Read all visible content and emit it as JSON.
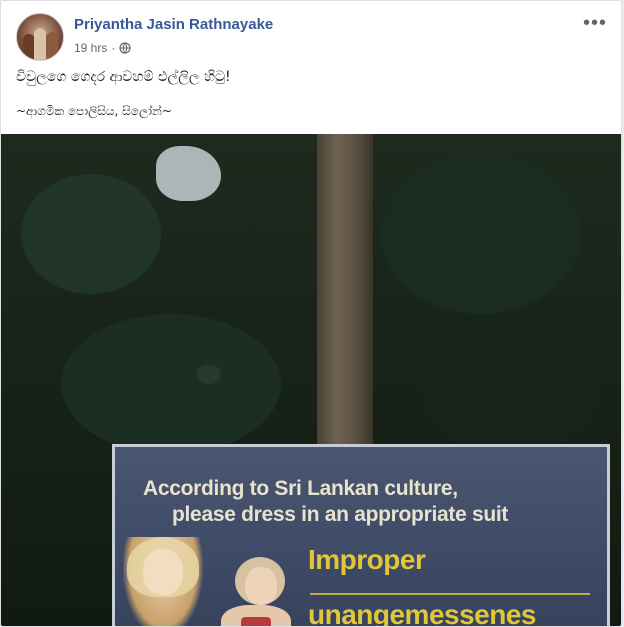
{
  "post": {
    "author": "Priyantha Jasin Rathnayake",
    "time": "19 hrs",
    "separator": "·",
    "privacy_icon": "globe-icon",
    "more_icon": "more-options-icon",
    "more_label": "•••",
    "text_line1": "විවුලගෙ ගෙදර ආවහම් එල්ලිල හිටු!",
    "text_line2": "~ආගමික පොලිසිය, සිලෝන්~"
  },
  "photo": {
    "sign_line1": "According to Sri Lankan culture,",
    "sign_line2": "please dress in an appropriate suit",
    "sign_word1": "Improper",
    "sign_word2": "unangemessenes"
  },
  "colors": {
    "link": "#385898",
    "meta": "#606770",
    "sign_text": "#e7e3cf",
    "sign_highlight": "#e1c63a"
  }
}
